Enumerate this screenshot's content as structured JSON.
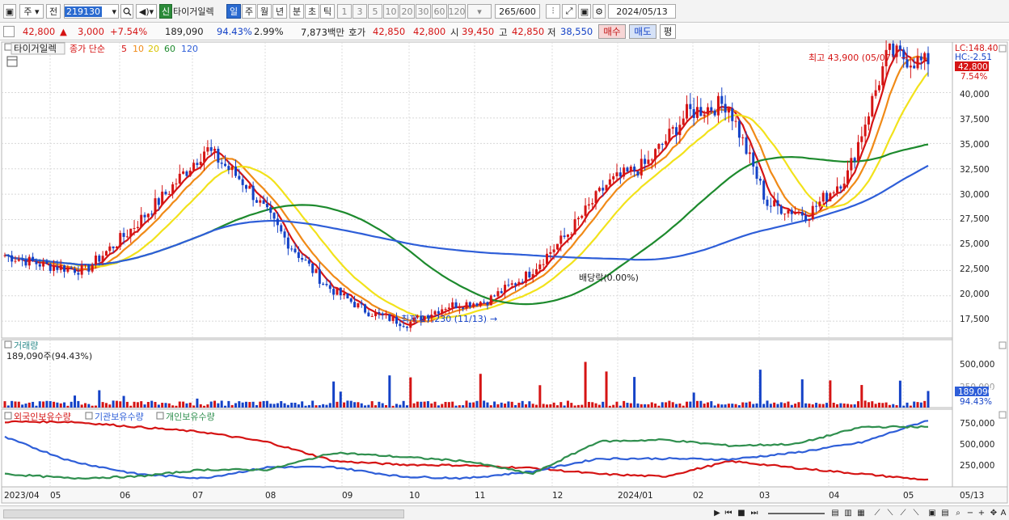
{
  "toolbar": {
    "market": "주",
    "prev": "전",
    "code": "219130",
    "stock_name": "타이거일렉",
    "new_badge": "신",
    "periods": [
      "일",
      "주",
      "월",
      "년",
      "분",
      "초",
      "틱"
    ],
    "selected_period": "일",
    "intervals": [
      "1",
      "3",
      "5",
      "10",
      "20",
      "30",
      "60",
      "120"
    ],
    "count": "265",
    "count_total": "/600",
    "date": "2024/05/13"
  },
  "quote": {
    "price": "42,800",
    "change": "3,000",
    "change_pct": "+7.54%",
    "volume": "189,090",
    "volume_ratio": "94.43%",
    "turnover": "2.99%",
    "amount": "7,873백만",
    "ask_label": "호가",
    "ask1": "42,850",
    "ask2": "42,800",
    "open_label": "시",
    "open": "39,450",
    "high_label": "고",
    "high": "42,850",
    "low_label": "저",
    "low": "38,550",
    "buy_label": "매수",
    "sell_label": "매도",
    "avg_label": "평"
  },
  "price_panel": {
    "title": "타이거일렉",
    "legend_label": "종가 단순",
    "ma": [
      {
        "period": "5",
        "color": "#d51414"
      },
      {
        "period": "10",
        "color": "#f08a17"
      },
      {
        "period": "20",
        "color": "#f2e21b"
      },
      {
        "period": "60",
        "color": "#1d8a2d"
      },
      {
        "period": "120",
        "color": "#2e5ed8"
      }
    ],
    "lc": "LC:148.40",
    "hc": "HC:-2.51",
    "last_price_tag": "42,800",
    "last_change_tag": "7.54%",
    "high_annotation": "최고 43,900 (05/07)",
    "low_annotation": "최저 17,230 (11/13)",
    "dividend_annotation": "배당락(0.00%)",
    "y_ticks": [
      "40,000",
      "37,500",
      "35,000",
      "32,500",
      "30,000",
      "27,500",
      "25,000",
      "22,500",
      "20,000",
      "17,500"
    ]
  },
  "volume_panel": {
    "title": "거래량",
    "value": "189,090주(94.43%)",
    "tag": "189,090",
    "tag_pct": "94.43%",
    "y_ticks": [
      "500,000",
      "250,000"
    ]
  },
  "holdings_panel": {
    "series": [
      {
        "name": "외국인보유수량",
        "color": "#d51414"
      },
      {
        "name": "기관보유수량",
        "color": "#2e5ed8"
      },
      {
        "name": "개인보유수량",
        "color": "#2f8f4e"
      }
    ],
    "y_ticks": [
      "750,000",
      "500,000",
      "250,000"
    ]
  },
  "x_axis": {
    "labels": [
      "2023/04",
      "05",
      "06",
      "07",
      "08",
      "09",
      "10",
      "11",
      "12",
      "2024/01",
      "02",
      "03",
      "04",
      "05"
    ],
    "right_label": "05/13"
  },
  "chart_data": {
    "type": "candlestick",
    "period": "daily",
    "date_range": [
      "2023/04",
      "2024/05/13"
    ],
    "moving_averages": [
      "5",
      "10",
      "20",
      "60",
      "120"
    ],
    "price_ylim": [
      16000,
      44500
    ],
    "close_path": [
      [
        "2023/04",
        24000
      ],
      [
        "05",
        23000
      ],
      [
        "06",
        22500
      ],
      [
        "07",
        26000
      ],
      [
        "07b",
        30000
      ],
      [
        "08",
        34500
      ],
      [
        "08b",
        31000
      ],
      [
        "09",
        25500
      ],
      [
        "10",
        21000
      ],
      [
        "11",
        18500
      ],
      [
        "11/13",
        17230
      ],
      [
        "12",
        19000
      ],
      [
        "2024/01",
        19500
      ],
      [
        "01b",
        22000
      ],
      [
        "02",
        26000
      ],
      [
        "02b",
        31000
      ],
      [
        "03",
        33000
      ],
      [
        "03b",
        38000
      ],
      [
        "04",
        39000
      ],
      [
        "04b",
        29000
      ],
      [
        "04c",
        28000
      ],
      [
        "05",
        32000
      ],
      [
        "05/07",
        43900
      ],
      [
        "05/13",
        42800
      ]
    ],
    "high": {
      "value": 43900,
      "date": "05/07"
    },
    "low": {
      "value": 17230,
      "date": "11/13"
    },
    "last": {
      "value": 42800,
      "change": 3000,
      "change_pct": 7.54
    },
    "volume_ylim": [
      0,
      700000
    ],
    "volume_last": 189090,
    "holdings_ylim": [
      0,
      850000
    ]
  }
}
